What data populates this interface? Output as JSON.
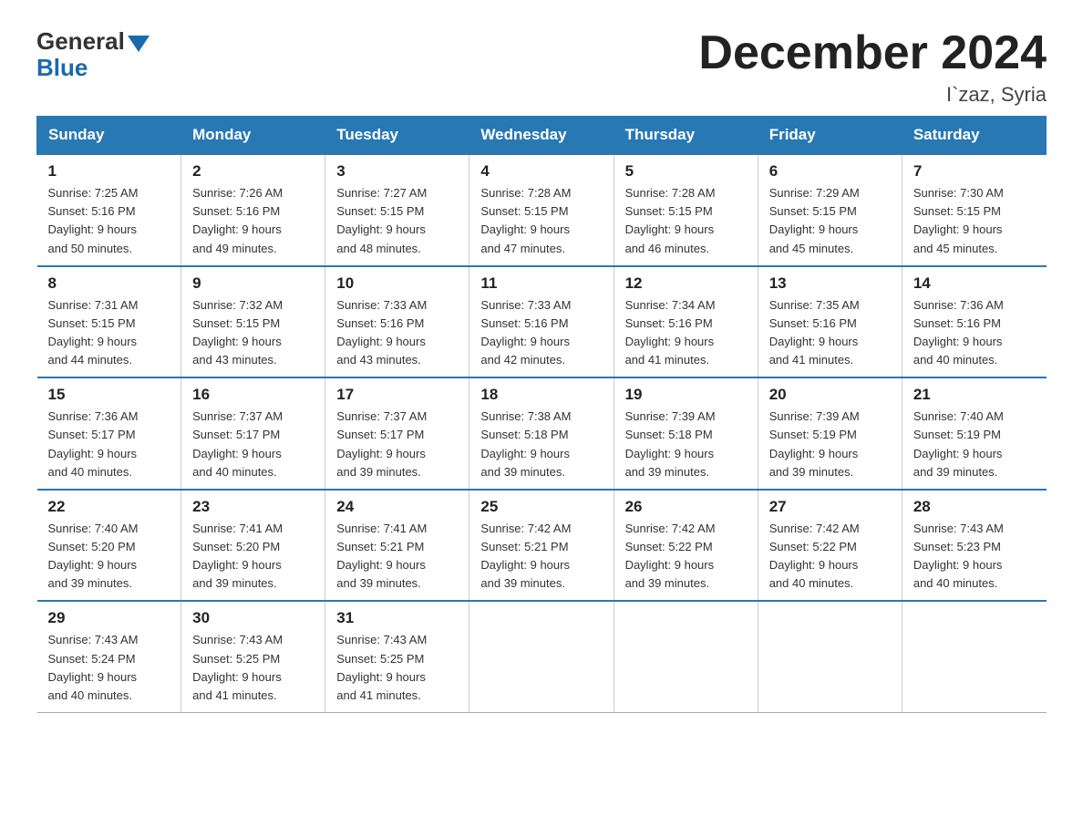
{
  "header": {
    "logo_general": "General",
    "logo_blue": "Blue",
    "title": "December 2024",
    "subtitle": "I`zaz, Syria"
  },
  "days_of_week": [
    "Sunday",
    "Monday",
    "Tuesday",
    "Wednesday",
    "Thursday",
    "Friday",
    "Saturday"
  ],
  "weeks": [
    [
      {
        "day": "1",
        "sunrise": "7:25 AM",
        "sunset": "5:16 PM",
        "daylight": "9 hours and 50 minutes."
      },
      {
        "day": "2",
        "sunrise": "7:26 AM",
        "sunset": "5:16 PM",
        "daylight": "9 hours and 49 minutes."
      },
      {
        "day": "3",
        "sunrise": "7:27 AM",
        "sunset": "5:15 PM",
        "daylight": "9 hours and 48 minutes."
      },
      {
        "day": "4",
        "sunrise": "7:28 AM",
        "sunset": "5:15 PM",
        "daylight": "9 hours and 47 minutes."
      },
      {
        "day": "5",
        "sunrise": "7:28 AM",
        "sunset": "5:15 PM",
        "daylight": "9 hours and 46 minutes."
      },
      {
        "day": "6",
        "sunrise": "7:29 AM",
        "sunset": "5:15 PM",
        "daylight": "9 hours and 45 minutes."
      },
      {
        "day": "7",
        "sunrise": "7:30 AM",
        "sunset": "5:15 PM",
        "daylight": "9 hours and 45 minutes."
      }
    ],
    [
      {
        "day": "8",
        "sunrise": "7:31 AM",
        "sunset": "5:15 PM",
        "daylight": "9 hours and 44 minutes."
      },
      {
        "day": "9",
        "sunrise": "7:32 AM",
        "sunset": "5:15 PM",
        "daylight": "9 hours and 43 minutes."
      },
      {
        "day": "10",
        "sunrise": "7:33 AM",
        "sunset": "5:16 PM",
        "daylight": "9 hours and 43 minutes."
      },
      {
        "day": "11",
        "sunrise": "7:33 AM",
        "sunset": "5:16 PM",
        "daylight": "9 hours and 42 minutes."
      },
      {
        "day": "12",
        "sunrise": "7:34 AM",
        "sunset": "5:16 PM",
        "daylight": "9 hours and 41 minutes."
      },
      {
        "day": "13",
        "sunrise": "7:35 AM",
        "sunset": "5:16 PM",
        "daylight": "9 hours and 41 minutes."
      },
      {
        "day": "14",
        "sunrise": "7:36 AM",
        "sunset": "5:16 PM",
        "daylight": "9 hours and 40 minutes."
      }
    ],
    [
      {
        "day": "15",
        "sunrise": "7:36 AM",
        "sunset": "5:17 PM",
        "daylight": "9 hours and 40 minutes."
      },
      {
        "day": "16",
        "sunrise": "7:37 AM",
        "sunset": "5:17 PM",
        "daylight": "9 hours and 40 minutes."
      },
      {
        "day": "17",
        "sunrise": "7:37 AM",
        "sunset": "5:17 PM",
        "daylight": "9 hours and 39 minutes."
      },
      {
        "day": "18",
        "sunrise": "7:38 AM",
        "sunset": "5:18 PM",
        "daylight": "9 hours and 39 minutes."
      },
      {
        "day": "19",
        "sunrise": "7:39 AM",
        "sunset": "5:18 PM",
        "daylight": "9 hours and 39 minutes."
      },
      {
        "day": "20",
        "sunrise": "7:39 AM",
        "sunset": "5:19 PM",
        "daylight": "9 hours and 39 minutes."
      },
      {
        "day": "21",
        "sunrise": "7:40 AM",
        "sunset": "5:19 PM",
        "daylight": "9 hours and 39 minutes."
      }
    ],
    [
      {
        "day": "22",
        "sunrise": "7:40 AM",
        "sunset": "5:20 PM",
        "daylight": "9 hours and 39 minutes."
      },
      {
        "day": "23",
        "sunrise": "7:41 AM",
        "sunset": "5:20 PM",
        "daylight": "9 hours and 39 minutes."
      },
      {
        "day": "24",
        "sunrise": "7:41 AM",
        "sunset": "5:21 PM",
        "daylight": "9 hours and 39 minutes."
      },
      {
        "day": "25",
        "sunrise": "7:42 AM",
        "sunset": "5:21 PM",
        "daylight": "9 hours and 39 minutes."
      },
      {
        "day": "26",
        "sunrise": "7:42 AM",
        "sunset": "5:22 PM",
        "daylight": "9 hours and 39 minutes."
      },
      {
        "day": "27",
        "sunrise": "7:42 AM",
        "sunset": "5:22 PM",
        "daylight": "9 hours and 40 minutes."
      },
      {
        "day": "28",
        "sunrise": "7:43 AM",
        "sunset": "5:23 PM",
        "daylight": "9 hours and 40 minutes."
      }
    ],
    [
      {
        "day": "29",
        "sunrise": "7:43 AM",
        "sunset": "5:24 PM",
        "daylight": "9 hours and 40 minutes."
      },
      {
        "day": "30",
        "sunrise": "7:43 AM",
        "sunset": "5:25 PM",
        "daylight": "9 hours and 41 minutes."
      },
      {
        "day": "31",
        "sunrise": "7:43 AM",
        "sunset": "5:25 PM",
        "daylight": "9 hours and 41 minutes."
      },
      null,
      null,
      null,
      null
    ]
  ],
  "labels": {
    "sunrise": "Sunrise:",
    "sunset": "Sunset:",
    "daylight": "Daylight:"
  }
}
